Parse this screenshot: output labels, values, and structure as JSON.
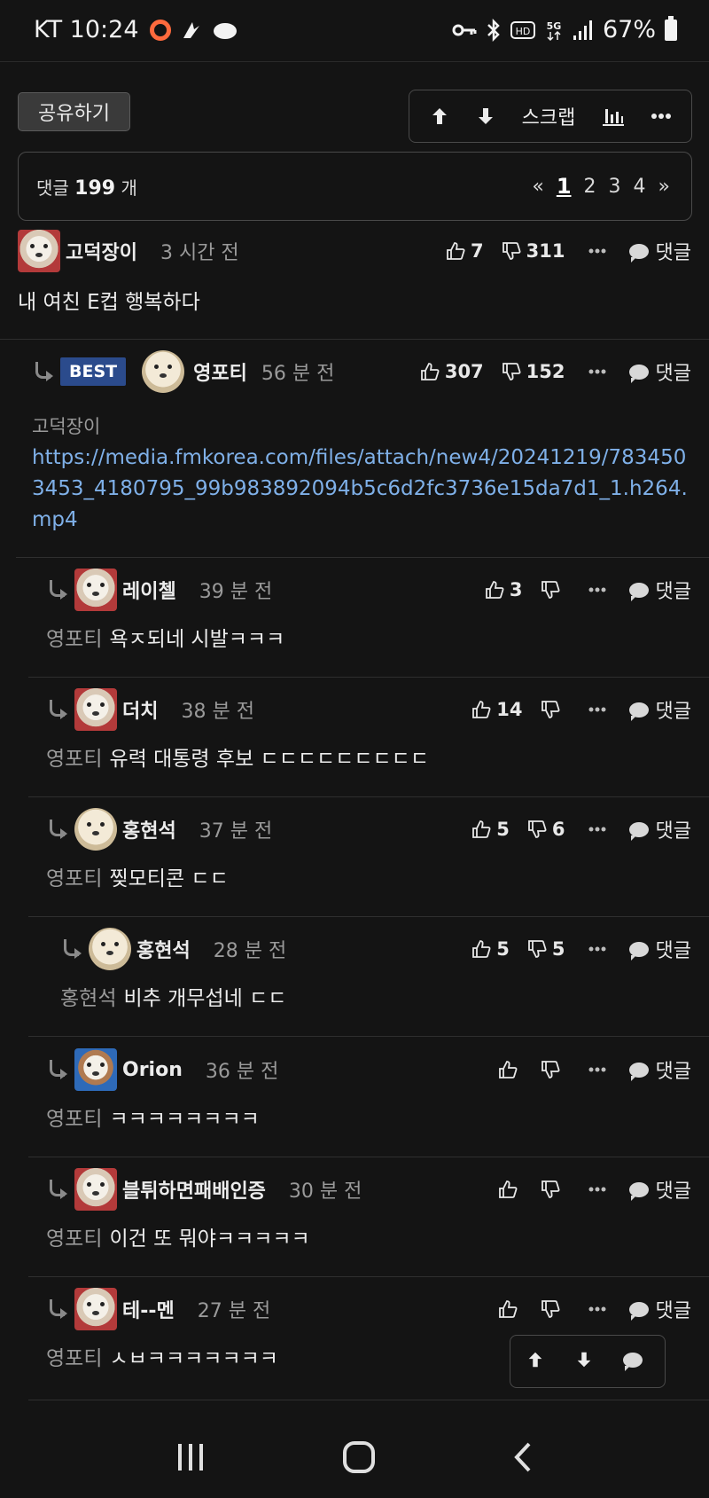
{
  "status": {
    "carrier_time": "KT 10:24",
    "battery": "67%"
  },
  "toolbar": {
    "share_label": "공유하기",
    "scrap_label": "스크랩"
  },
  "comments_header": {
    "prefix": "댓글",
    "count": "199",
    "suffix": "개",
    "pages": [
      "«",
      "1",
      "2",
      "3",
      "4",
      "»"
    ],
    "current_page": "1"
  },
  "reply_label": "댓글",
  "best_label": "BEST",
  "comments": [
    {
      "nick": "고덕장이",
      "time": "3 시간 전",
      "up": "7",
      "down": "311",
      "mention": "",
      "text": "내 여친 E컵 행복하다"
    },
    {
      "nick": "영포티",
      "time": "56 분 전",
      "up": "307",
      "down": "152",
      "mention": "고덕장이",
      "text": "https://media.fmkorea.com/files/attach/new4/20241219/7834503453_4180795_99b983892094b5c6d2fc3736e15da7d1_1.h264.mp4"
    },
    {
      "nick": "레이첼",
      "time": "39 분 전",
      "up": "3",
      "down": "",
      "mention": "영포티",
      "text": "욕ㅈ되네 시발ㅋㅋㅋ"
    },
    {
      "nick": "더치",
      "time": "38 분 전",
      "up": "14",
      "down": "",
      "mention": "영포티",
      "text": "유력 대통령 후보 ㄷㄷㄷㄷㄷㄷㄷㄷㄷ"
    },
    {
      "nick": "홍현석",
      "time": "37 분 전",
      "up": "5",
      "down": "6",
      "mention": "영포티",
      "text": "찢모티콘 ㄷㄷ"
    },
    {
      "nick": "홍현석",
      "time": "28 분 전",
      "up": "5",
      "down": "5",
      "mention": "홍현석",
      "text": "비추 개무섭네 ㄷㄷ"
    },
    {
      "nick": "Orion",
      "time": "36 분 전",
      "up": "",
      "down": "",
      "mention": "영포티",
      "text": "ㅋㅋㅋㅋㅋㅋㅋㅋ"
    },
    {
      "nick": "블튀하면패배인증",
      "time": "30 분 전",
      "up": "",
      "down": "",
      "mention": "영포티",
      "text": "이건 또 뭐야ㅋㅋㅋㅋㅋ"
    },
    {
      "nick": "테--멘",
      "time": "27 분 전",
      "up": "",
      "down": "",
      "mention": "영포티",
      "text": "ㅅㅂㅋㅋㅋㅋㅋㅋㅋ"
    }
  ]
}
